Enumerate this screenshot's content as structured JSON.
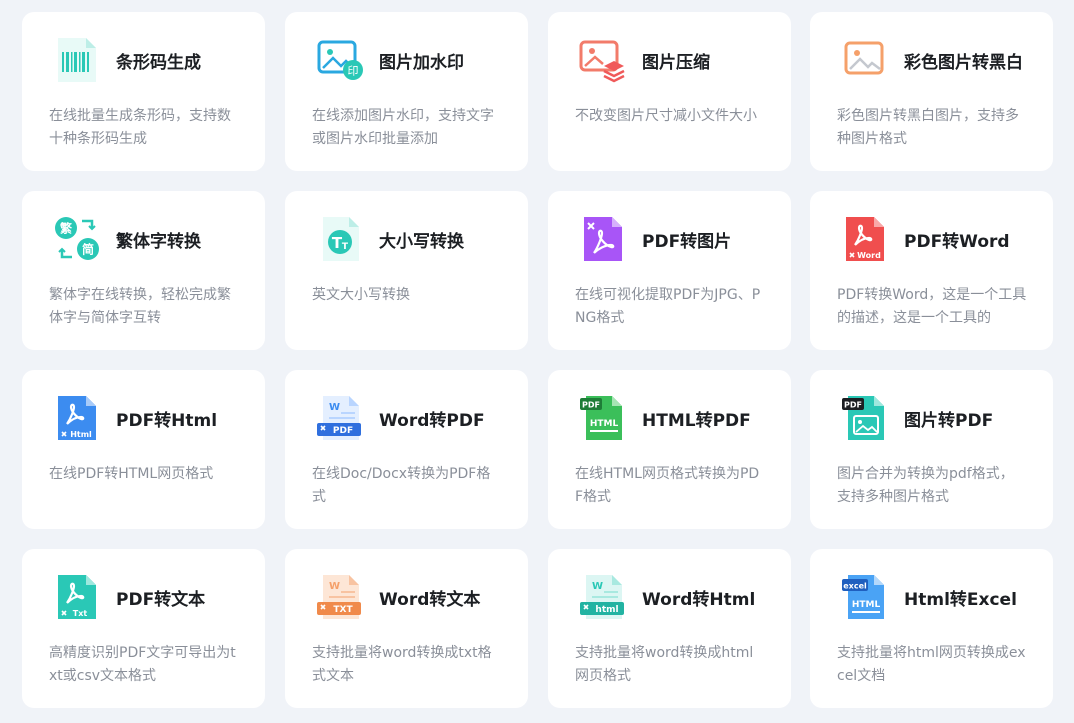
{
  "tools": [
    {
      "key": "barcode",
      "icon": "barcode-icon",
      "title": "条形码生成",
      "desc": "在线批量生成条形码，支持数十种条形码生成"
    },
    {
      "key": "watermark",
      "icon": "image-watermark-icon",
      "title": "图片加水印",
      "desc": "在线添加图片水印，支持文字或图片水印批量添加"
    },
    {
      "key": "compress",
      "icon": "image-compress-icon",
      "title": "图片压缩",
      "desc": "不改变图片尺寸减小文件大小"
    },
    {
      "key": "grayscale",
      "icon": "image-grayscale-icon",
      "title": "彩色图片转黑白",
      "desc": "彩色图片转黑白图片，支持多种图片格式"
    },
    {
      "key": "traditional",
      "icon": "traditional-simplified-icon",
      "title": "繁体字转换",
      "desc": "繁体字在线转换，轻松完成繁体字与简体字互转"
    },
    {
      "key": "case",
      "icon": "text-case-icon",
      "title": "大小写转换",
      "desc": "英文大小写转换"
    },
    {
      "key": "pdf2img",
      "icon": "pdf-to-image-icon",
      "title": "PDF转图片",
      "desc": "在线可视化提取PDF为JPG、PNG格式"
    },
    {
      "key": "pdf2word",
      "icon": "pdf-to-word-icon",
      "title": "PDF转Word",
      "desc": "PDF转换Word，这是一个工具的描述，这是一个工具的"
    },
    {
      "key": "pdf2html",
      "icon": "pdf-to-html-icon",
      "title": "PDF转Html",
      "desc": "在线PDF转HTML网页格式"
    },
    {
      "key": "word2pdf",
      "icon": "word-to-pdf-icon",
      "title": "Word转PDF",
      "desc": "在线Doc/Docx转换为PDF格式"
    },
    {
      "key": "html2pdf",
      "icon": "html-to-pdf-icon",
      "title": "HTML转PDF",
      "desc": "在线HTML网页格式转换为PDF格式"
    },
    {
      "key": "img2pdf",
      "icon": "image-to-pdf-icon",
      "title": "图片转PDF",
      "desc": "图片合并为转换为pdf格式，支持多种图片格式"
    },
    {
      "key": "pdf2txt",
      "icon": "pdf-to-text-icon",
      "title": "PDF转文本",
      "desc": "高精度识别PDF文字可导出为txt或csv文本格式"
    },
    {
      "key": "word2txt",
      "icon": "word-to-text-icon",
      "title": "Word转文本",
      "desc": "支持批量将word转换成txt格式文本"
    },
    {
      "key": "word2html",
      "icon": "word-to-html-icon",
      "title": "Word转Html",
      "desc": "支持批量将word转换成html网页格式"
    },
    {
      "key": "html2excel",
      "icon": "html-to-excel-icon",
      "title": "Html转Excel",
      "desc": "支持批量将html网页转换成excel文档"
    }
  ],
  "icon_labels": {
    "watermark_badge": "印",
    "trad": "繁",
    "simp": "简",
    "case_big": "T",
    "case_small": "T",
    "word_file": "Word",
    "html_file": "Html",
    "pdf_badge": "PDF",
    "html_badge": "HTML",
    "txt_badge": "TXT",
    "txt_file": "Txt",
    "html_small": "html",
    "w_letter": "W",
    "excel_badge": "excel",
    "html_caps": "HTML"
  },
  "colors": {
    "background": "#f0f3f8",
    "card": "#ffffff",
    "title": "#1c1f23",
    "desc": "#8a8f99",
    "teal": "#2ac8b6",
    "blue": "#3c8cf0",
    "red": "#f04e4e",
    "purple": "#a855f7",
    "green": "#3bbf5a",
    "orange": "#f5a06a",
    "salmon": "#f27b6a"
  }
}
